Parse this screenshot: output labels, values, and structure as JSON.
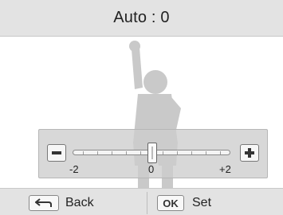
{
  "header": {
    "title": "Auto : 0"
  },
  "slider": {
    "min_label": "-2",
    "mid_label": "0",
    "max_label": "+2",
    "value": 0,
    "range": [
      -2,
      2
    ],
    "minus_icon": "minus-icon",
    "plus_icon": "plus-icon"
  },
  "footer": {
    "back_key_icon": "return-arrow-icon",
    "back_label": "Back",
    "ok_key_label": "OK",
    "set_label": "Set"
  }
}
